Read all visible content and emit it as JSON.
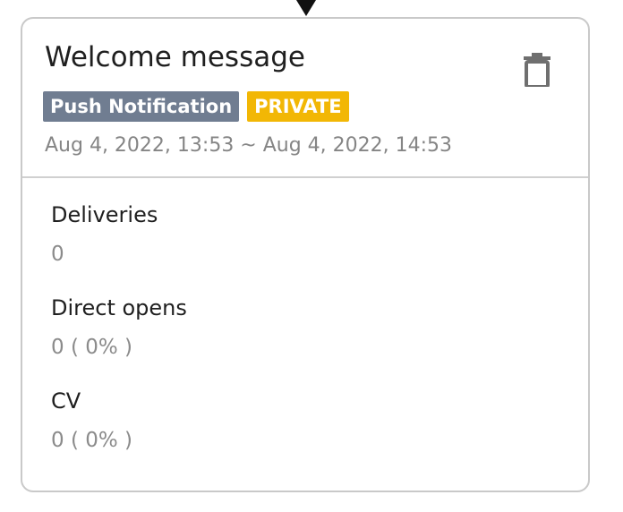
{
  "card": {
    "title": "Welcome message",
    "badges": {
      "type": "Push Notification",
      "visibility": "PRIVATE"
    },
    "date_range": "Aug 4, 2022, 13:53 ~ Aug 4, 2022, 14:53",
    "actions": {
      "delete_icon": "trash-icon"
    }
  },
  "metrics": {
    "deliveries": {
      "label": "Deliveries",
      "value": "0"
    },
    "direct_opens": {
      "label": "Direct opens",
      "value": "0 ( 0% )"
    },
    "cv": {
      "label": "CV",
      "value": "0 ( 0% )"
    }
  },
  "colors": {
    "push_badge": "#707d91",
    "private_badge": "#f2b705",
    "border": "#c9c9c9",
    "muted_text": "#858585"
  }
}
